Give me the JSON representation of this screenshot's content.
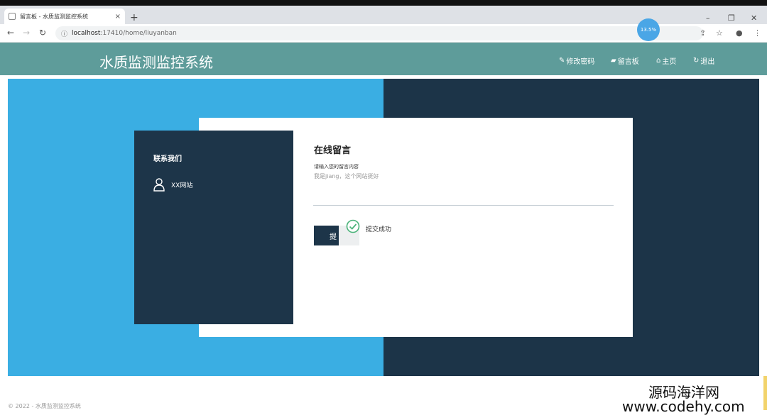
{
  "browser": {
    "tab_title": "留言板 - 水质监测监控系统",
    "tab_close": "×",
    "new_tab": "+",
    "url_host": "localhost",
    "url_path": ":17410/home/liuyanban",
    "profile_bubble": "13.5%",
    "win_min": "–",
    "win_max": "❐",
    "win_close": "✕"
  },
  "app": {
    "title": "水质监测监控系统",
    "nav": [
      {
        "label": "修改密码",
        "icon": "pencil-icon"
      },
      {
        "label": "留言板",
        "icon": "chat-icon"
      },
      {
        "label": "主页",
        "icon": "home-icon"
      },
      {
        "label": "退出",
        "icon": "refresh-icon"
      }
    ]
  },
  "contact": {
    "heading": "联系我们",
    "site_label": "XX网站"
  },
  "form": {
    "title": "在线留言",
    "field_label": "请输入您的留言内容",
    "field_value": "我是jiang，这个网站挺好",
    "submit_label": "提",
    "toast_message": "提交成功"
  },
  "footer": {
    "copyright": "© 2022 - 水质监测监控系统"
  },
  "watermark": {
    "line1": "源码海洋网",
    "line2": "www.codehy.com"
  },
  "colors": {
    "nav_bg": "#5e9c9a",
    "hero_left": "#3aaee3",
    "hero_right": "#1c3448",
    "panel": "#1d3549",
    "success": "#4bb37a"
  }
}
